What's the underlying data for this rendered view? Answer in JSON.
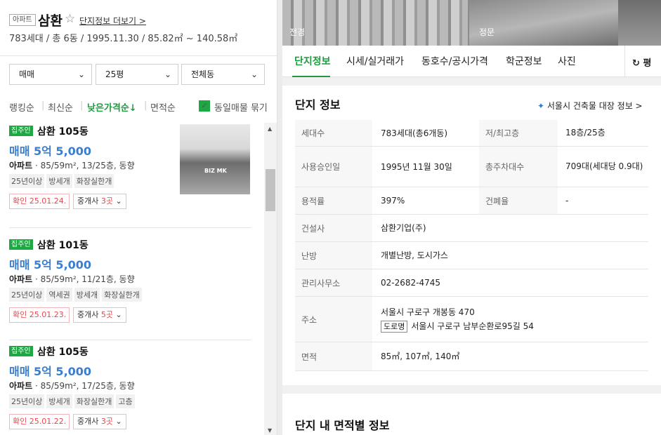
{
  "complex": {
    "type": "아파트",
    "name": "삼환",
    "star": "☆",
    "more_link": "단지정보 더보기 >",
    "summary": "783세대 / 총 6동 / 1995.11.30 / 85.82㎡ ~ 140.58㎡"
  },
  "filters": {
    "trade": "매매",
    "size": "25평",
    "building": "전체동",
    "caret": "⌄"
  },
  "sort": {
    "ranking": "랭킹순",
    "latest": "최신순",
    "low_price": "낮은가격순↓",
    "area": "면적순",
    "sep": "|",
    "check_mark": "✓",
    "group_label": "동일매물 묶기"
  },
  "listings": [
    {
      "tag": "집주인",
      "name": "삼환 105동",
      "price": "매매 5억 5,000",
      "spec_type": "아파트",
      "spec_rest": " · 85/59m², 13/25층, 동향",
      "chips": [
        "25년이상",
        "방세개",
        "화장실한개"
      ],
      "confirmed": "확인 25.01.24.",
      "agent_prefix": "중개사 ",
      "agent_count": "3곳",
      "agent_caret": "⌄",
      "photo_watermark": "BIZ MK"
    },
    {
      "tag": "집주인",
      "name": "삼환 101동",
      "price": "매매 5억 5,000",
      "spec_type": "아파트",
      "spec_rest": " · 85/59m², 11/21층, 동향",
      "chips": [
        "25년이상",
        "역세권",
        "방세개",
        "화장실한개"
      ],
      "confirmed": "확인 25.01.23.",
      "agent_prefix": "중개사 ",
      "agent_count": "5곳",
      "agent_caret": "⌄"
    },
    {
      "tag": "집주인",
      "name": "삼환 105동",
      "price": "매매 5억 5,000",
      "spec_type": "아파트",
      "spec_rest": " · 85/59m², 17/25층, 동향",
      "chips": [
        "25년이상",
        "방세개",
        "화장실한개",
        "고층"
      ],
      "confirmed": "확인 25.01.22.",
      "agent_prefix": "중개사 ",
      "agent_count": "3곳",
      "agent_caret": "⌄"
    }
  ],
  "scrollbar": {
    "up": "▲",
    "down": "▼"
  },
  "photos": {
    "front": "전경",
    "gate": "정문"
  },
  "tabs": {
    "items": [
      "단지정보",
      "시세/실거래가",
      "동호수/공시가격",
      "학군정보",
      "사진"
    ],
    "refresh": "↻ 평"
  },
  "info": {
    "title": "단지 정보",
    "building_link_icon": "✦",
    "building_link": "서울시 건축물 대장 정보 >",
    "rows": [
      {
        "k": "세대수",
        "v": "783세대(총6개동)",
        "k2": "저/최고층",
        "v2": "18층/25층"
      },
      {
        "k": "사용승인일",
        "v": "1995년 11월 30일",
        "k2": "총주차대수",
        "v2": "709대(세대당 0.9대)"
      },
      {
        "k": "용적률",
        "v": "397%",
        "k2": "건폐율",
        "v2": "-"
      },
      {
        "k": "건설사",
        "v": "삼환기업(주)"
      },
      {
        "k": "난방",
        "v": "개별난방, 도시가스"
      },
      {
        "k": "관리사무소",
        "v": "02-2682-4745"
      },
      {
        "k": "주소",
        "v": "서울시 구로구 개봉동 470",
        "road_tag": "도로명",
        "road_addr": "서울시 구로구 남부순환로95길 54"
      },
      {
        "k": "면적",
        "v": "85㎡, 107㎡, 140㎡"
      }
    ]
  },
  "area_section": {
    "title": "단지 내 면적별 정보"
  },
  "colors": {
    "accent_green": "#1d9b3e",
    "price_blue": "#3a7ed1",
    "confirm_red": "#e5484d"
  }
}
